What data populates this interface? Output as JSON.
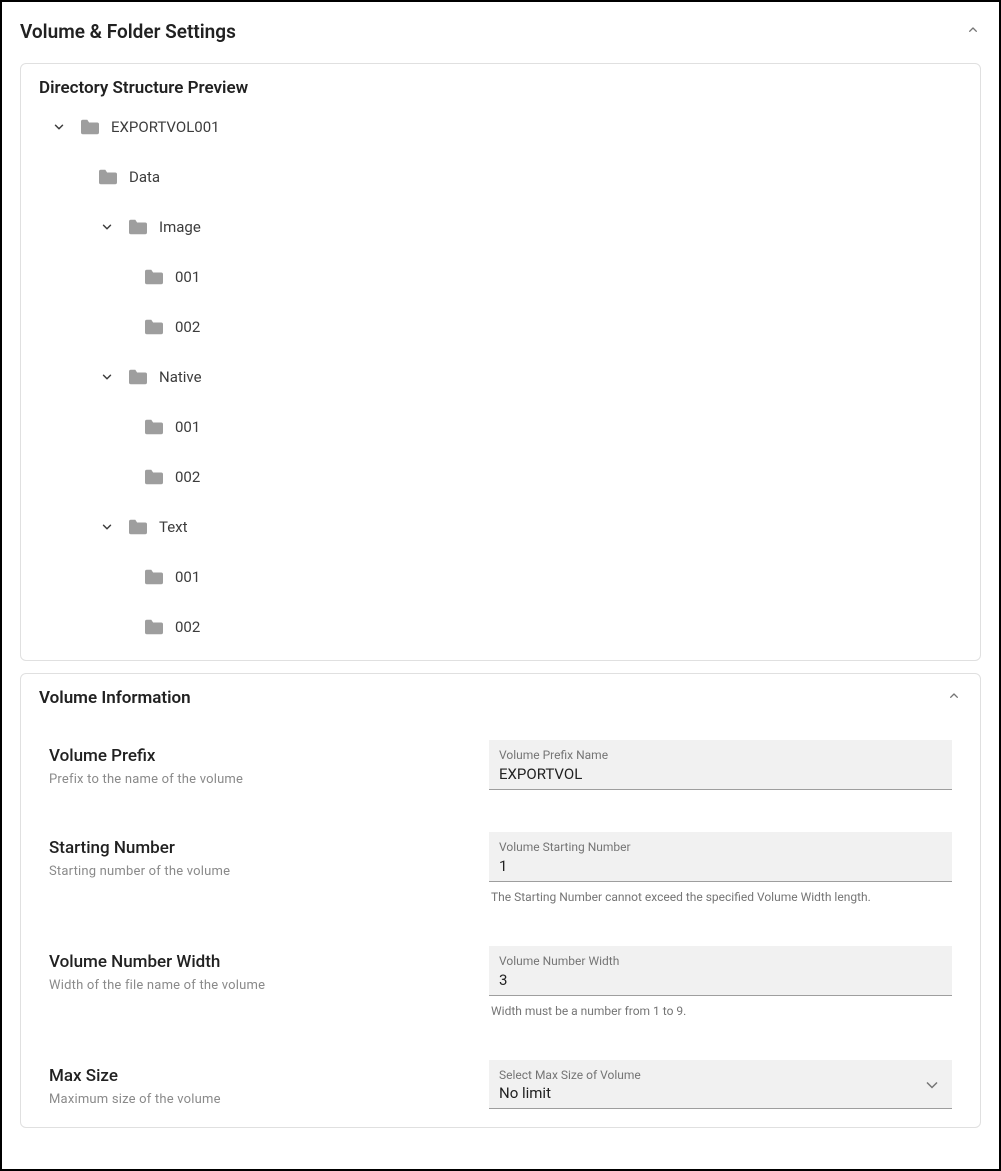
{
  "header": {
    "title": "Volume & Folder Settings"
  },
  "preview": {
    "title": "Directory Structure Preview",
    "tree": {
      "root": "EXPORTVOL001",
      "children": [
        {
          "name": "Data",
          "expandable": false
        },
        {
          "name": "Image",
          "expandable": true,
          "children": [
            "001",
            "002"
          ]
        },
        {
          "name": "Native",
          "expandable": true,
          "children": [
            "001",
            "002"
          ]
        },
        {
          "name": "Text",
          "expandable": true,
          "children": [
            "001",
            "002"
          ]
        }
      ]
    }
  },
  "volumeInfo": {
    "title": "Volume Information",
    "rows": {
      "prefix": {
        "label": "Volume Prefix",
        "desc": "Prefix to the name of the volume",
        "inputLabel": "Volume Prefix Name",
        "value": "EXPORTVOL"
      },
      "starting": {
        "label": "Starting Number",
        "desc": "Starting number of the volume",
        "inputLabel": "Volume Starting Number",
        "value": "1",
        "helper": "The Starting Number cannot exceed the specified Volume Width length."
      },
      "width": {
        "label": "Volume Number Width",
        "desc": "Width of the file name of the volume",
        "inputLabel": "Volume Number Width",
        "value": "3",
        "helper": "Width must be a number from 1 to 9."
      },
      "maxsize": {
        "label": "Max Size",
        "desc": "Maximum size of the volume",
        "inputLabel": "Select Max Size of Volume",
        "value": "No limit"
      }
    }
  }
}
